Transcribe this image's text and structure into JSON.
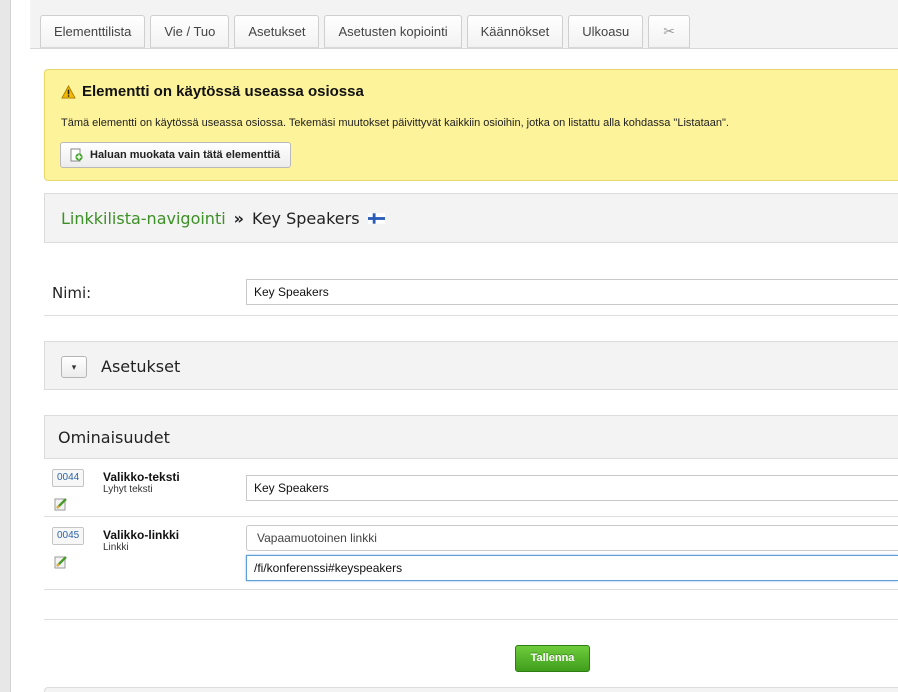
{
  "tabs": [
    {
      "label": "Elementtilista"
    },
    {
      "label": "Vie / Tuo"
    },
    {
      "label": "Asetukset"
    },
    {
      "label": "Asetusten kopiointi"
    },
    {
      "label": "Käännökset"
    },
    {
      "label": "Ulkoasu"
    },
    {
      "label": "✂"
    }
  ],
  "warning": {
    "title": "Elementti on käytössä useassa osiossa",
    "text": "Tämä elementti on käytössä useassa osiossa. Tekemäsi muutokset päivittyvät kaikkiin osioihin, jotka on listattu alla kohdassa \"Listataan\".",
    "button_label": "Haluan muokata vain tätä elementtiä",
    "icon": "warning-icon"
  },
  "breadcrumb": {
    "parent": "Linkkilista-navigointi",
    "separator": "»",
    "current": "Key Speakers",
    "flag_icon": "finnish-flag-icon"
  },
  "name_field": {
    "label": "Nimi:",
    "value": "Key Speakers"
  },
  "settings_section": {
    "toggle_icon": "▾",
    "label": "Asetukset"
  },
  "properties": {
    "heading": "Ominaisuudet",
    "items": [
      {
        "id": "0044",
        "name": "Valikko-teksti",
        "type": "Lyhyt teksti",
        "value": "Key Speakers"
      },
      {
        "id": "0045",
        "name": "Valikko-linkki",
        "type": "Linkki",
        "select_value": "Vapaamuotoinen linkki",
        "value": "/fi/konferenssi#keyspeakers"
      }
    ]
  },
  "save_label": "Tallenna",
  "colors": {
    "accent_green": "#3d8f27",
    "warning_bg": "#fdf39a",
    "save_button": "#4fb526",
    "id_badge_text": "#2c63a9"
  }
}
